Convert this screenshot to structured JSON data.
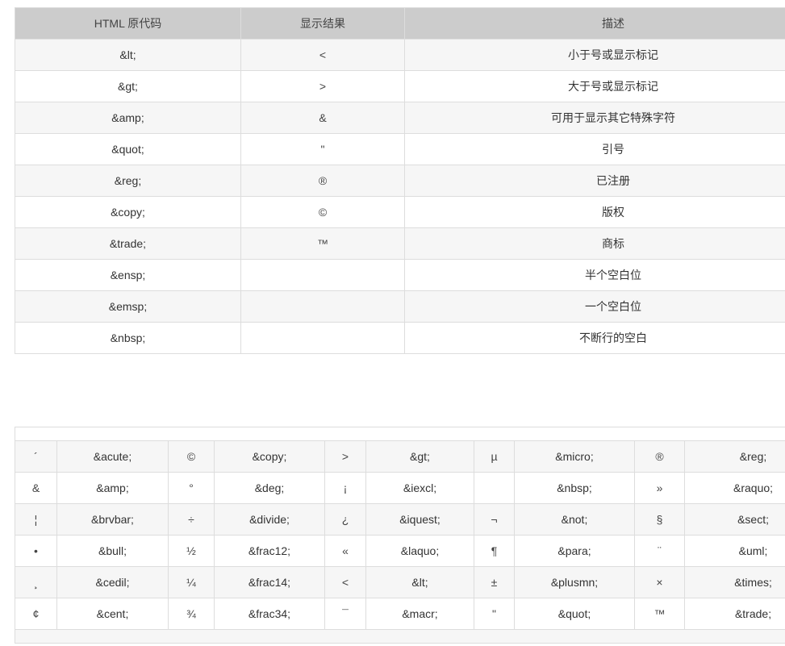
{
  "table1": {
    "headers": [
      "HTML 原代码",
      "显示结果",
      "描述"
    ],
    "rows": [
      {
        "code": "&lt;",
        "display": "<",
        "desc": "小于号或显示标记"
      },
      {
        "code": "&gt;",
        "display": ">",
        "desc": "大于号或显示标记"
      },
      {
        "code": "&amp;",
        "display": "&",
        "desc": "可用于显示其它特殊字符"
      },
      {
        "code": "&quot;",
        "display": "\"",
        "desc": "引号"
      },
      {
        "code": "&reg;",
        "display": "®",
        "desc": "已注册"
      },
      {
        "code": "&copy;",
        "display": "©",
        "desc": "版权"
      },
      {
        "code": "&trade;",
        "display": "™",
        "desc": "商标"
      },
      {
        "code": "&ensp;",
        "display": "",
        "desc": "半个空白位"
      },
      {
        "code": "&emsp;",
        "display": "",
        "desc": "一个空白位"
      },
      {
        "code": "&nbsp;",
        "display": "",
        "desc": "不断行的空白"
      }
    ]
  },
  "table2": {
    "rows": [
      [
        {
          "sym": "´",
          "code": "&acute;"
        },
        {
          "sym": "©",
          "code": "&copy;"
        },
        {
          "sym": ">",
          "code": "&gt;"
        },
        {
          "sym": "µ",
          "code": "&micro;"
        },
        {
          "sym": "®",
          "code": "&reg;"
        }
      ],
      [
        {
          "sym": "&",
          "code": "&amp;"
        },
        {
          "sym": "°",
          "code": "&deg;"
        },
        {
          "sym": "¡",
          "code": "&iexcl;"
        },
        {
          "sym": "",
          "code": "&nbsp;"
        },
        {
          "sym": "»",
          "code": "&raquo;"
        }
      ],
      [
        {
          "sym": "¦",
          "code": "&brvbar;"
        },
        {
          "sym": "÷",
          "code": "&divide;"
        },
        {
          "sym": "¿",
          "code": "&iquest;"
        },
        {
          "sym": "¬",
          "code": "&not;"
        },
        {
          "sym": "§",
          "code": "&sect;"
        }
      ],
      [
        {
          "sym": "•",
          "code": "&bull;"
        },
        {
          "sym": "½",
          "code": "&frac12;"
        },
        {
          "sym": "«",
          "code": "&laquo;"
        },
        {
          "sym": "¶",
          "code": "&para;"
        },
        {
          "sym": "¨",
          "code": "&uml;"
        }
      ],
      [
        {
          "sym": "¸",
          "code": "&cedil;"
        },
        {
          "sym": "¼",
          "code": "&frac14;"
        },
        {
          "sym": "<",
          "code": "&lt;"
        },
        {
          "sym": "±",
          "code": "&plusmn;"
        },
        {
          "sym": "×",
          "code": "&times;"
        }
      ],
      [
        {
          "sym": "¢",
          "code": "&cent;"
        },
        {
          "sym": "¾",
          "code": "&frac34;"
        },
        {
          "sym": "¯",
          "code": "&macr;"
        },
        {
          "sym": "\"",
          "code": "&quot;"
        },
        {
          "sym": "™",
          "code": "&trade;"
        }
      ]
    ]
  }
}
